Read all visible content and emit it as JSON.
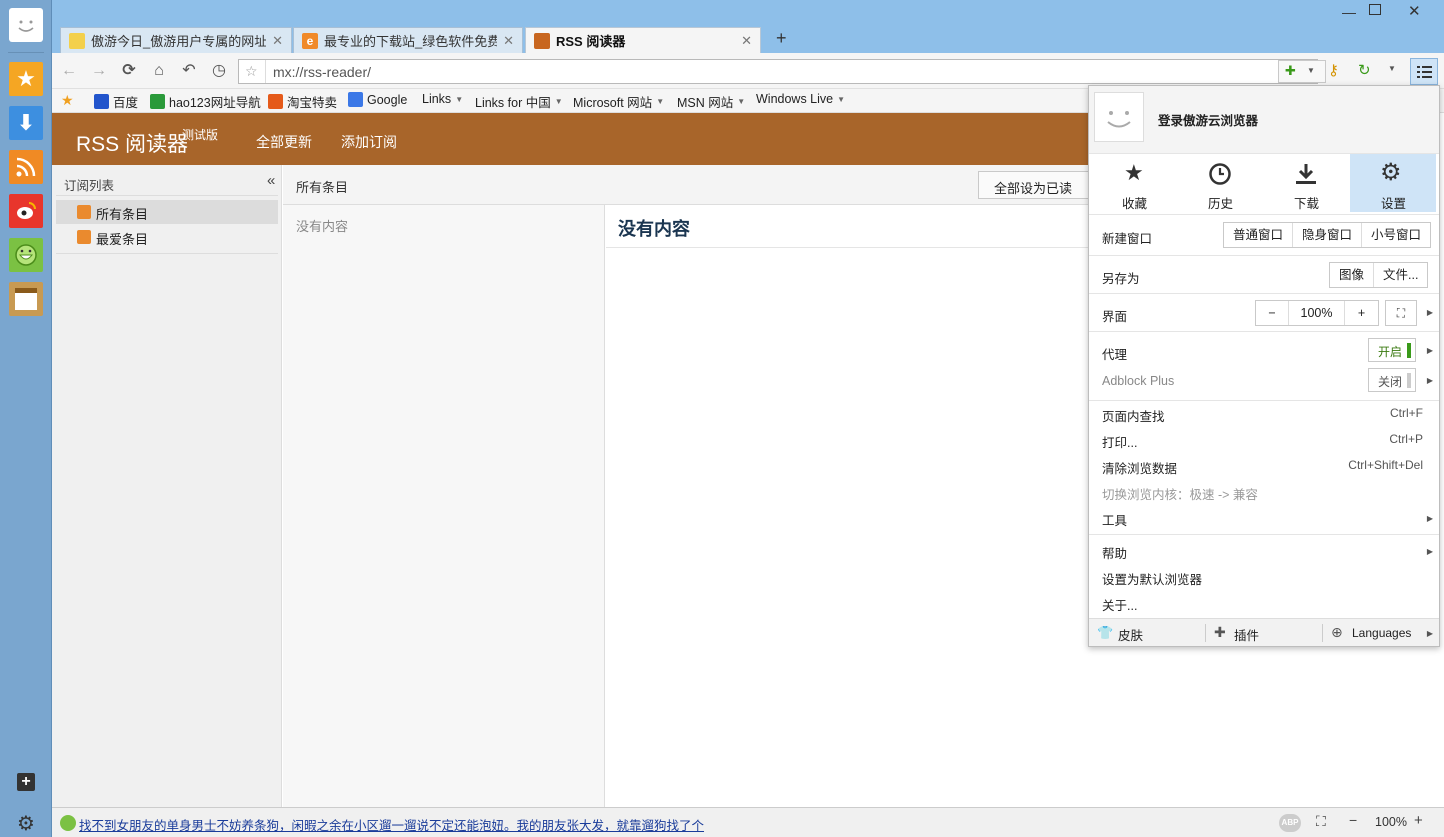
{
  "tabs": [
    {
      "label": "傲游今日_傲游用户专属的网址...",
      "icon_color": "#f3d04c"
    },
    {
      "label": "最专业的下载站_绿色软件免费...",
      "icon_color": "#f08a2a"
    },
    {
      "label": "RSS 阅读器",
      "icon_color": "#c8661f"
    }
  ],
  "new_tab": "+",
  "address": {
    "value": "mx://rss-reader/"
  },
  "bookmarks": [
    {
      "label": "百度",
      "icon_color": "#2255cc"
    },
    {
      "label": "hao123网址导航",
      "icon_color": "#2a9a3a"
    },
    {
      "label": "淘宝特卖",
      "icon_color": "#e55a1a"
    },
    {
      "label": "Google",
      "icon_color": "#3b78e7"
    },
    {
      "label": "Links",
      "arrow": true
    },
    {
      "label": "Links for 中国",
      "arrow": true
    },
    {
      "label": "Microsoft 网站",
      "arrow": true
    },
    {
      "label": "MSN 网站",
      "arrow": true
    },
    {
      "label": "Windows Live",
      "arrow": true
    }
  ],
  "rss": {
    "title": "RSS 阅读器",
    "beta": "测试版",
    "update_all": "全部更新",
    "add_sub": "添加订阅",
    "feed_list_title": "订阅列表",
    "collapse": "«",
    "feeds": [
      "所有条目",
      "最爱条目"
    ],
    "current_section": "所有条目",
    "mark_all_read": "全部设为已读",
    "no_content_list": "没有内容",
    "no_content_title": "没有内容"
  },
  "menu": {
    "login": "登录傲游云浏览器",
    "quick": [
      {
        "label": "收藏",
        "icon": "star-icon"
      },
      {
        "label": "历史",
        "icon": "clock-icon"
      },
      {
        "label": "下载",
        "icon": "download-icon"
      },
      {
        "label": "设置",
        "icon": "gear-icon"
      }
    ],
    "new_window": "新建窗口",
    "new_window_opts": [
      "普通窗口",
      "隐身窗口",
      "小号窗口"
    ],
    "save_as": "另存为",
    "save_as_opts": [
      "图像",
      "文件..."
    ],
    "interface": "界面",
    "zoom_minus": "−",
    "zoom": "100%",
    "zoom_plus": "+",
    "proxy": "代理",
    "proxy_state": "开启",
    "adblock": "Adblock Plus",
    "adblock_state": "关闭",
    "find": "页面内查找",
    "find_key": "Ctrl+F",
    "print": "打印...",
    "print_key": "Ctrl+P",
    "clear": "清除浏览数据",
    "clear_key": "Ctrl+Shift+Del",
    "switch_core": "切换浏览内核：极速 -> 兼容",
    "tools": "工具",
    "help": "帮助",
    "set_default": "设置为默认浏览器",
    "about": "关于...",
    "skin": "皮肤",
    "plugins": "插件",
    "languages": "Languages"
  },
  "status": {
    "news": "找不到女朋友的单身男士不妨养条狗，闲暇之余在小区遛一遛说不定还能泡妞。我的朋友张大发，就靠遛狗找了个",
    "abp": "ABP",
    "zoom": "100%"
  },
  "colors": {
    "rss_brown": "#a8652a",
    "sidebar": "#7aa6cf",
    "titlebar": "#8ebfe9",
    "highlight": "#cfe4f7"
  }
}
